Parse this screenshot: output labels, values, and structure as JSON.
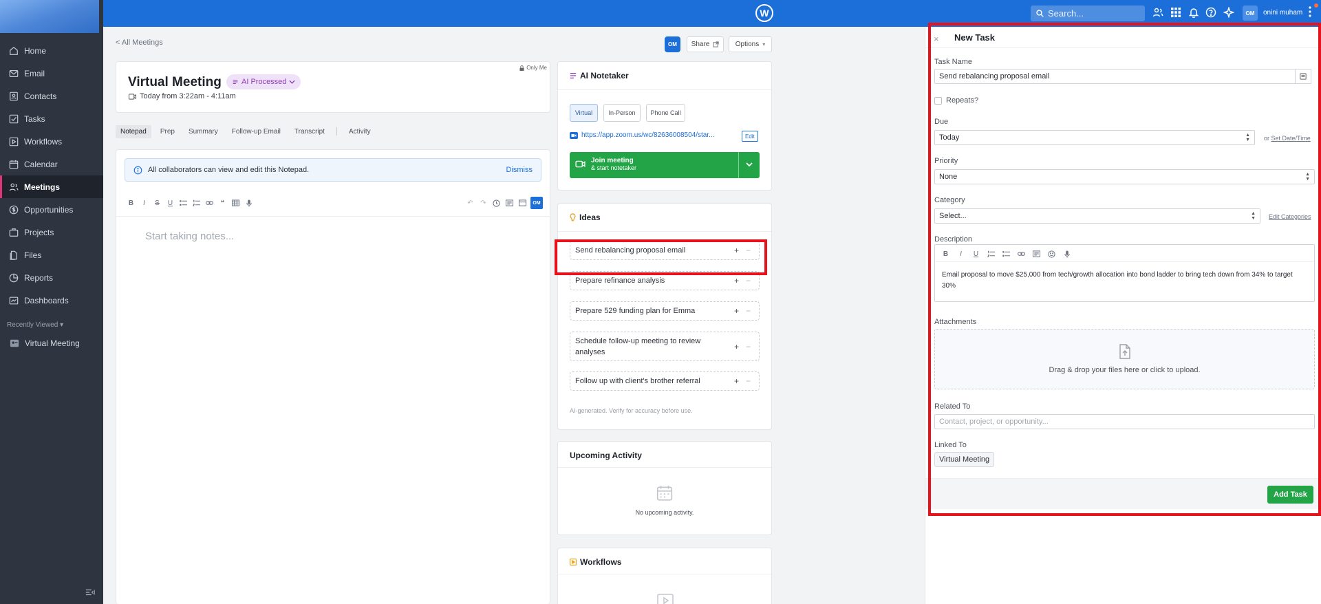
{
  "topbar": {
    "search_placeholder": "Search...",
    "avatar_initials": "OM",
    "user_name": "onini muham"
  },
  "sidebar": {
    "items": [
      {
        "label": "Home",
        "icon": "home-icon"
      },
      {
        "label": "Email",
        "icon": "mail-icon"
      },
      {
        "label": "Contacts",
        "icon": "contacts-icon"
      },
      {
        "label": "Tasks",
        "icon": "tasks-icon"
      },
      {
        "label": "Workflows",
        "icon": "workflows-icon"
      },
      {
        "label": "Calendar",
        "icon": "calendar-icon"
      },
      {
        "label": "Meetings",
        "icon": "meetings-icon",
        "active": true
      },
      {
        "label": "Opportunities",
        "icon": "dollar-icon"
      },
      {
        "label": "Projects",
        "icon": "projects-icon"
      },
      {
        "label": "Files",
        "icon": "files-icon"
      },
      {
        "label": "Reports",
        "icon": "reports-icon"
      },
      {
        "label": "Dashboards",
        "icon": "dashboards-icon"
      }
    ],
    "recent_title": "Recently Viewed",
    "recent_items": [
      "Virtual Meeting"
    ]
  },
  "meeting": {
    "back_link": "< All Meetings",
    "header_avatar": "OM",
    "share_label": "Share",
    "options_label": "Options",
    "visibility": "Only Me",
    "title": "Virtual Meeting",
    "ai_badge": "AI Processed",
    "time": "Today from 3:22am - 4:11am",
    "tabs": [
      "Notepad",
      "Prep",
      "Summary",
      "Follow-up Email",
      "Transcript",
      "Activity"
    ],
    "active_tab": "Notepad",
    "info_text": "All collaborators can view and edit this Notepad.",
    "dismiss_label": "Dismiss",
    "toolbar_avatar": "OM",
    "notes_placeholder": "Start taking notes..."
  },
  "ai_notetaker": {
    "title": "AI Notetaker",
    "modes": [
      "Virtual",
      "In-Person",
      "Phone Call"
    ],
    "selected_mode": "Virtual",
    "link": "https://app.zoom.us/wc/82636008504/star...",
    "edit_label": "Edit",
    "join_label": "Join meeting",
    "join_sub": "& start notetaker"
  },
  "ideas": {
    "title": "Ideas",
    "items": [
      "Send rebalancing proposal email",
      "Prepare refinance analysis",
      "Prepare 529 funding plan for Emma",
      "Schedule follow-up meeting to review analyses",
      "Follow up with client's brother referral"
    ],
    "footer": "AI-generated. Verify for accuracy before use."
  },
  "upcoming": {
    "title": "Upcoming Activity",
    "empty": "No upcoming activity."
  },
  "workflows": {
    "title": "Workflows"
  },
  "new_task": {
    "title": "New Task",
    "task_name_label": "Task Name",
    "task_name_value": "Send rebalancing proposal email",
    "repeats_label": "Repeats?",
    "due_label": "Due",
    "due_value": "Today",
    "or_text": "or",
    "set_date_label": "Set Date/Time",
    "priority_label": "Priority",
    "priority_value": "None",
    "category_label": "Category",
    "category_value": "Select...",
    "edit_categories_label": "Edit Categories",
    "description_label": "Description",
    "description_value": "Email proposal to move $25,000 from tech/growth allocation into bond ladder to bring tech down from 34% to target 30%",
    "attachments_label": "Attachments",
    "drop_text": "Drag & drop your files here or click to upload.",
    "related_label": "Related To",
    "related_placeholder": "Contact, project, or opportunity...",
    "linked_label": "Linked To",
    "linked_value": "Virtual Meeting",
    "add_task_label": "Add Task"
  },
  "colors": {
    "accent": "#1c6fd9",
    "success": "#22a447",
    "sidebar": "#2e3440",
    "highlight": "#e8121c"
  }
}
